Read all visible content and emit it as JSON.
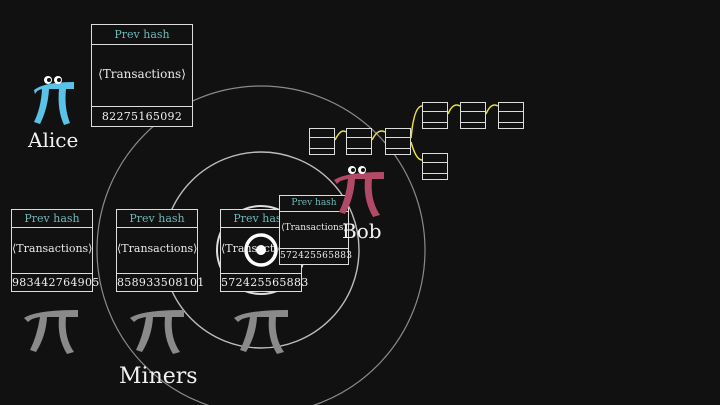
{
  "characters": {
    "alice": {
      "name": "Alice",
      "color": "#5bc2e7"
    },
    "bob": {
      "name": "Bob",
      "color": "#b04a66"
    },
    "miners_label": "Miners",
    "miner_color": "#8a8a8a"
  },
  "alice_block": {
    "prev_hash": "Prev hash",
    "transactions": "⟨Transactions⟩",
    "nonce": "82275165092"
  },
  "miner_blocks": [
    {
      "prev_hash": "Prev hash",
      "transactions": "⟨Transactions⟩",
      "nonce": "983442764905"
    },
    {
      "prev_hash": "Prev hash",
      "transactions": "⟨Transactions⟩",
      "nonce": "858933508101"
    },
    {
      "prev_hash": "Prev hash",
      "transactions": "⟨Transactions⟩",
      "nonce": "572425565883"
    }
  ],
  "broadcast_block": {
    "prev_hash": "Prev hash",
    "transactions": "⟨Transactions⟩",
    "nonce": "572425565883"
  },
  "chain": {
    "link_color": "#e8e040"
  }
}
